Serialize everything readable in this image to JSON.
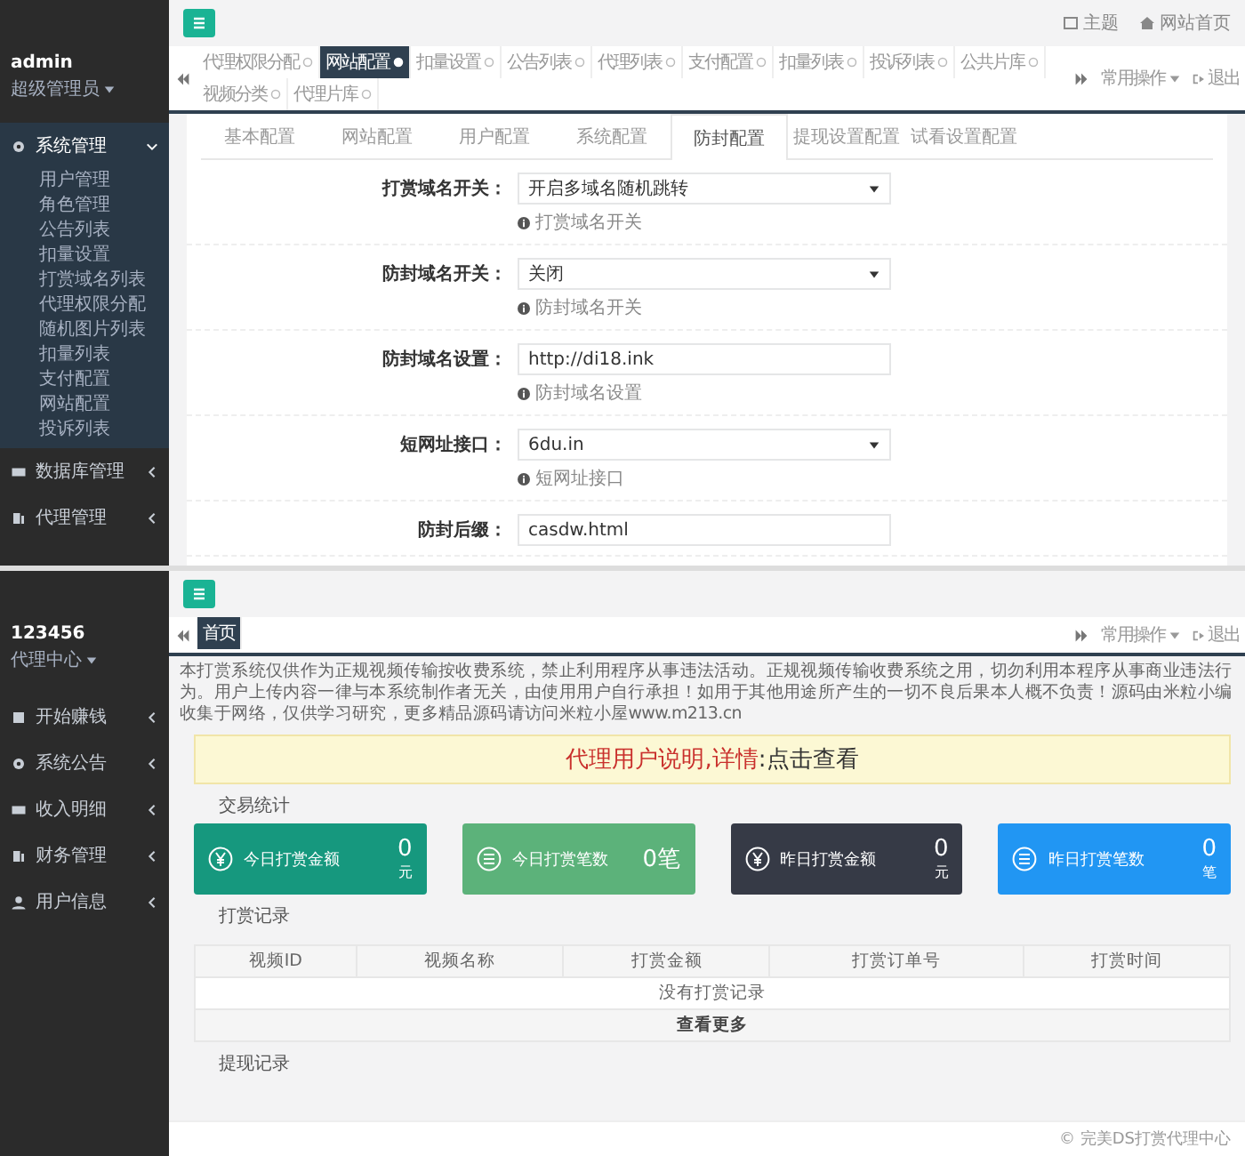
{
  "admin_panel": {
    "header": {
      "links": [
        "主题",
        "网站首页"
      ]
    },
    "user": {
      "name": "admin",
      "role": "超级管理员"
    },
    "menu": [
      {
        "label": "系统管理",
        "expanded": true,
        "children": [
          "用户管理",
          "角色管理",
          "公告列表",
          "扣量设置",
          "打赏域名列表",
          "代理权限分配",
          "随机图片列表",
          "扣量列表",
          "支付配置",
          "网站配置",
          "投诉列表"
        ]
      },
      {
        "label": "数据库管理",
        "expanded": false
      },
      {
        "label": "代理管理",
        "expanded": false
      }
    ],
    "tabs": [
      {
        "label": "代理权限分配",
        "selected": false
      },
      {
        "label": "网站配置",
        "selected": true
      },
      {
        "label": "扣量设置",
        "selected": false
      },
      {
        "label": "公告列表",
        "selected": false
      },
      {
        "label": "代理列表",
        "selected": false
      },
      {
        "label": "支付配置",
        "selected": false
      },
      {
        "label": "扣量列表",
        "selected": false
      },
      {
        "label": "投诉列表",
        "selected": false
      },
      {
        "label": "公共片库",
        "selected": false
      },
      {
        "label": "视频分类",
        "selected": false
      },
      {
        "label": "代理片库",
        "selected": false
      }
    ],
    "tab_actions": {
      "menu": "常用操作",
      "exit": "退出"
    },
    "sub_tabs": [
      {
        "label": "基本配置",
        "selected": false
      },
      {
        "label": "网站配置",
        "selected": false
      },
      {
        "label": "用户配置",
        "selected": false
      },
      {
        "label": "系统配置",
        "selected": false
      },
      {
        "label": "防封配置",
        "selected": true
      },
      {
        "label": "提现设置配置",
        "selected": false
      },
      {
        "label": "试看设置配置",
        "selected": false
      }
    ],
    "form": [
      {
        "label": "打赏域名开关：",
        "kind": "select",
        "value": "开启多域名随机跳转",
        "hint": "打赏域名开关"
      },
      {
        "label": "防封域名开关：",
        "kind": "select",
        "value": "关闭",
        "hint": "防封域名开关"
      },
      {
        "label": "防封域名设置：",
        "kind": "input",
        "value": "http://di18.ink",
        "hint": "防封域名设置"
      },
      {
        "label": "短网址接口：",
        "kind": "select",
        "value": "6du.in",
        "hint": "短网址接口"
      },
      {
        "label": "防封后缀：",
        "kind": "input",
        "value": "casdw.html"
      }
    ]
  },
  "agent_panel": {
    "user": {
      "name": "123456",
      "role": "代理中心"
    },
    "menu": [
      {
        "label": "开始赚钱",
        "expanded": false
      },
      {
        "label": "系统公告",
        "expanded": false
      },
      {
        "label": "收入明细",
        "expanded": false
      },
      {
        "label": "财务管理",
        "expanded": false
      },
      {
        "label": "用户信息",
        "expanded": false
      }
    ],
    "tabs": [
      {
        "label": "首页",
        "selected": true
      }
    ],
    "tab_actions": {
      "menu": "常用操作",
      "exit": "退出"
    },
    "notice": "本打赏系统仅供作为正规视频传输按收费系统，禁止利用程序从事违法活动。正规视频传输收费系统之用，切勿利用本程序从事商业违法行为。用户上传内容一律与本系统制作者无关，由使用用户自行承担！如用于其他用途所产生的一切不良后果本人概不负责！源码由米粒小编收集于网络，仅供学习研究，更多精品源码请访问米粒小屋www.m213.cn",
    "banner": {
      "title": "代理用户说明,详情",
      "link": ":点击查看"
    },
    "stats_title": "交易统计",
    "stats": [
      {
        "label": "今日打赏金额",
        "value": "0",
        "unit": "元",
        "color": "#16987e"
      },
      {
        "label": "今日打赏笔数",
        "value": "0笔",
        "color": "#5cb27a"
      },
      {
        "label": "昨日打赏金额",
        "value": "0",
        "unit": "元",
        "color": "#363a46"
      },
      {
        "label": "昨日打赏笔数",
        "value": "0",
        "unit": "笔",
        "color": "#2196f3"
      }
    ],
    "records_title": "打赏记录",
    "table": {
      "columns": [
        "视频ID",
        "视频名称",
        "打赏金额",
        "打赏订单号",
        "打赏时间"
      ],
      "empty": "没有打赏记录",
      "more": "查看更多"
    },
    "next_title": "提现记录",
    "footer": "© 完美DS打赏代理中心"
  }
}
